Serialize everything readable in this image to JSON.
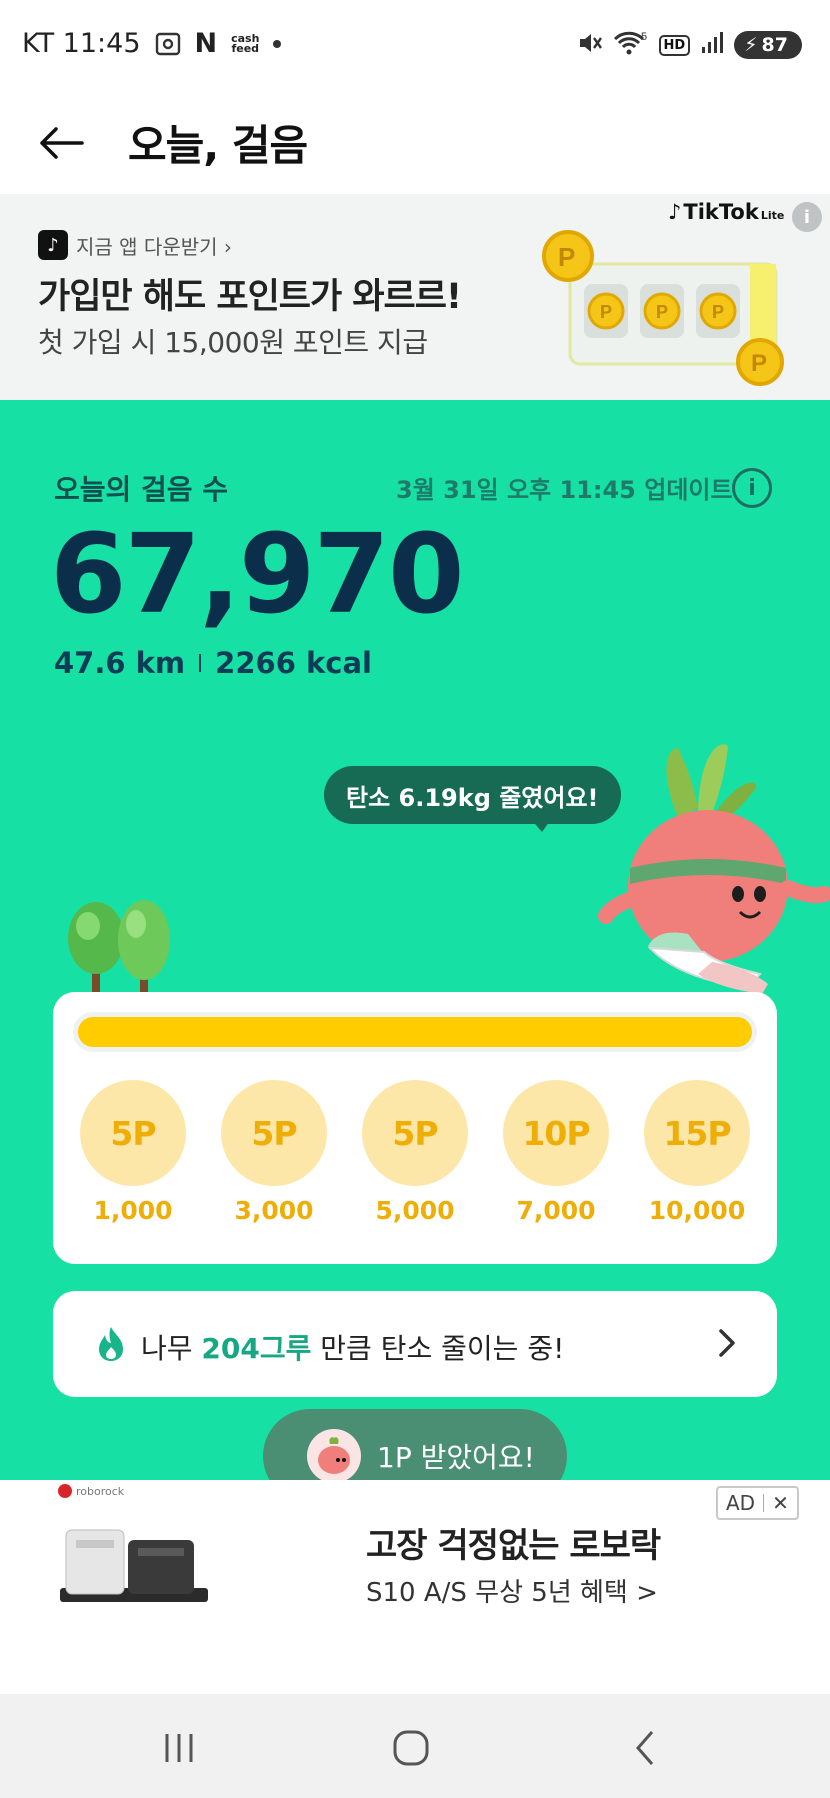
{
  "status_bar": {
    "carrier_time": "KT 11:45",
    "n_icon": "N",
    "cashfeed_top": "cash",
    "cashfeed_bottom": "feed",
    "network": "5",
    "hd": "HD",
    "battery": "87"
  },
  "header": {
    "title": "오늘, 걸음"
  },
  "promo": {
    "small_text": "지금 앱 다운받기 ›",
    "title": "가입만 해도 포인트가 와르르!",
    "subtitle": "첫 가입 시 15,000원 포인트 지급",
    "brand": "TikTok",
    "brand_suffix": "Lite",
    "info": "i"
  },
  "steps": {
    "label": "오늘의 걸음 수",
    "updated": "3월 31일 오후 11:45 업데이트",
    "info": "i",
    "count": "67,970",
    "distance": "47.6 km",
    "calories": "2266 kcal",
    "speech": "탄소 6.19kg 줄였어요!"
  },
  "rewards": {
    "progress": 1.0,
    "items": [
      {
        "points": "5P",
        "steps": "1,000"
      },
      {
        "points": "5P",
        "steps": "3,000"
      },
      {
        "points": "5P",
        "steps": "5,000"
      },
      {
        "points": "10P",
        "steps": "7,000"
      },
      {
        "points": "15P",
        "steps": "10,000"
      }
    ]
  },
  "tree_card": {
    "prefix": "나무 ",
    "count": "204그루",
    "suffix": " 만큼 탄소 줄이는 중!"
  },
  "toast": {
    "text": "1P 받았어요!"
  },
  "ad": {
    "brand": "roborock",
    "title": "고장 걱정없는 로보락",
    "subtitle": "S10 A/S 무상 5년 혜택 >",
    "badge": "AD",
    "close": "✕"
  },
  "colors": {
    "green_bg": "#17e0a5",
    "dark_text": "#0b2f4a",
    "reward_yellow": "#efae07",
    "progress_yellow": "#ffcc00",
    "tree_accent": "#16a784"
  }
}
